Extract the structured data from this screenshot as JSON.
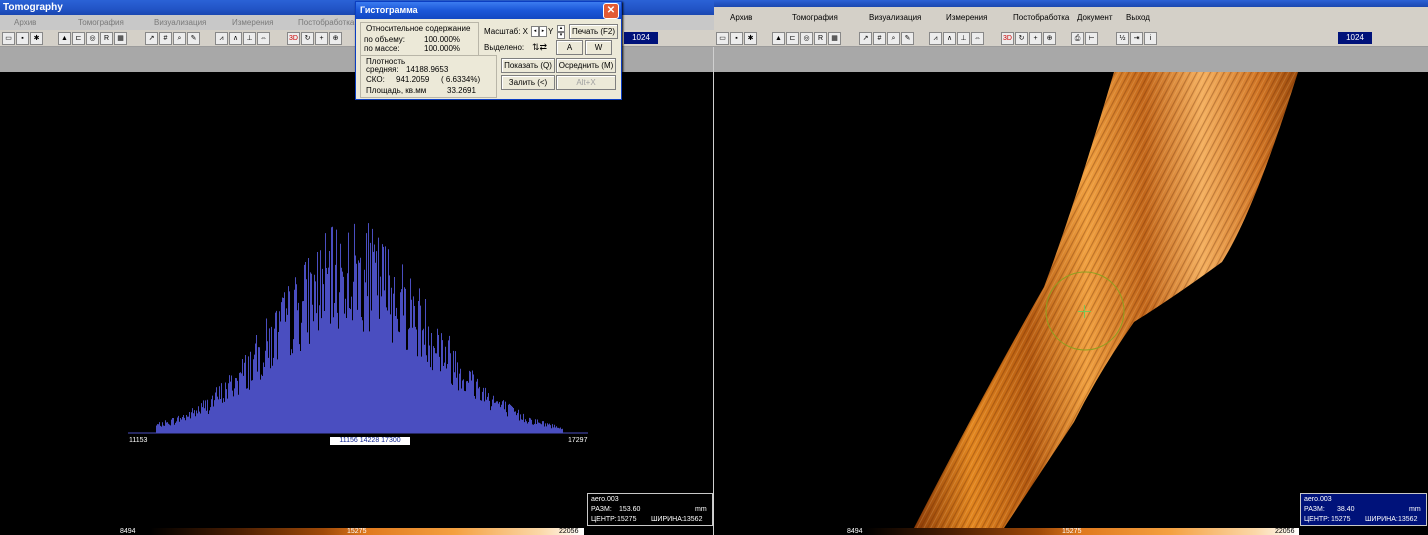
{
  "app": {
    "title": "Tomography"
  },
  "menu_left": [
    "Архив",
    "Томография",
    "Визуализация",
    "Измерения",
    "Постобработка"
  ],
  "menu_right": [
    "Архив",
    "Томография",
    "Визуализация",
    "Измерения",
    "Постобработка",
    "Документ",
    "Выход"
  ],
  "toolbar": {
    "count_left": "1024",
    "count_right": "1024",
    "btn_3d": "3D"
  },
  "dialog": {
    "title": "Гистограмма",
    "relative_content": "Относительное содержание",
    "by_volume_label": "по объему:",
    "by_volume_value": "100.000%",
    "by_mass_label": "по массе:",
    "by_mass_value": "100.000%",
    "density_header": "Плотность",
    "mean_label": "средняя:",
    "mean_value": "14188.9653",
    "sko_label": "СКО:",
    "sko_value": "941.2059",
    "sko_pct": "(    6.6334%)",
    "area_label": "Площадь, кв.мм",
    "area_value": "33.2691",
    "scale_label": "Масштаб: X",
    "scale_y": "Y",
    "print_btn": "Печать (F2)",
    "selected_label": "Выделено:",
    "a_btn": "A",
    "w_btn": "W",
    "show_btn": "Показать (Q)",
    "average_btn": "Осреднить (M)",
    "fill_btn": "Залить (<)",
    "altx_btn": "Alt+X"
  },
  "histogram": {
    "min_label": "11153",
    "max_label": "17297",
    "range_text": "11156  14228  17300",
    "bar_color": "#4a4ec0"
  },
  "info_left": {
    "name": "aero.003",
    "size_label": "РАЗМ:",
    "size_value": "153.60",
    "unit": "mm",
    "center_label": "ЦЕНТР:",
    "center_value": "15275",
    "width_label": "ШИРИНА:",
    "width_value": "13562"
  },
  "info_right": {
    "name": "aero.003",
    "size_label": "РАЗМ:",
    "size_value": "38.40",
    "unit": "mm",
    "center_label": "ЦЕНТР:",
    "center_value": "15275",
    "width_label": "ШИРИНА:",
    "width_value": "13562"
  },
  "colorbar": {
    "min": "8494",
    "mid": "15275",
    "max": "22056"
  },
  "colors": {
    "title_bar": "#2254c6",
    "specimen": "#e07a1e",
    "info_bg": "#00127a"
  }
}
